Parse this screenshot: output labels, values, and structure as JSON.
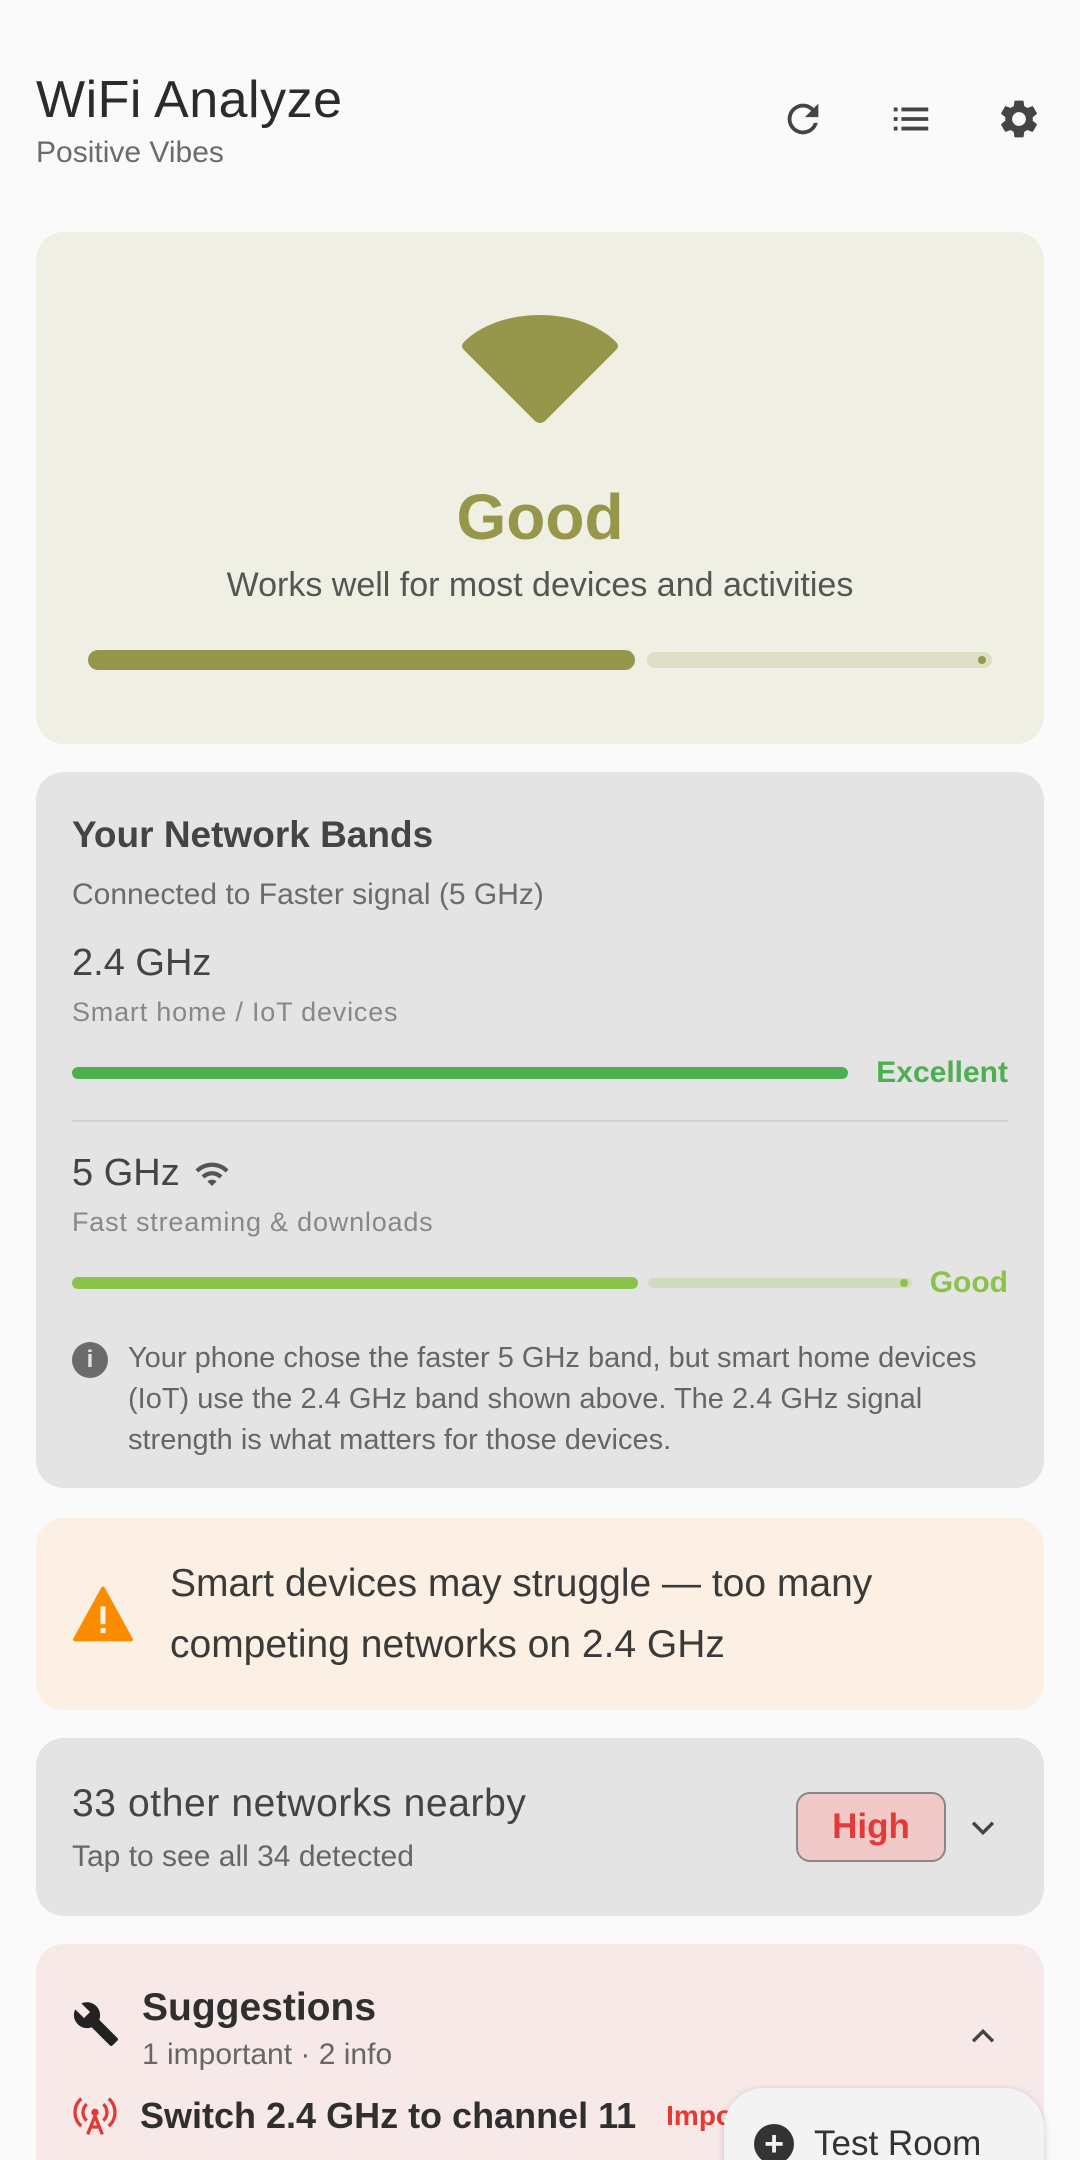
{
  "header": {
    "title": "WiFi Analyze",
    "subtitle": "Positive Vibes",
    "actions": [
      "refresh-icon",
      "list-icon",
      "settings-icon"
    ]
  },
  "status": {
    "label": "Good",
    "description": "Works well for most devices and activities",
    "level": 0.72,
    "color": "#96974a"
  },
  "bands": {
    "title": "Your Network Bands",
    "connected": "Connected to Faster signal (5 GHz)",
    "items": [
      {
        "name": "2.4 GHz",
        "desc": "Smart home / IoT devices",
        "rating": "Excellent",
        "level": 1.0,
        "color": "#4caf50"
      },
      {
        "name": "5 GHz",
        "desc": "Fast streaming & downloads",
        "rating": "Good",
        "level": 0.72,
        "color": "#8bc34a",
        "icon": "wifi-icon"
      }
    ],
    "info": "Your phone chose the faster 5 GHz band, but smart home devices (IoT) use the 2.4 GHz band shown above. The 2.4 GHz signal strength is what matters for those devices."
  },
  "warning": {
    "text": "Smart devices may struggle — too many competing networks on 2.4 GHz",
    "icon": "warning-icon",
    "color": "#fb8c00"
  },
  "nearby": {
    "title": "33 other networks nearby",
    "subtitle": "Tap to see all 34 detected",
    "badge": "High"
  },
  "suggestions": {
    "title": "Suggestions",
    "subtitle": "1 important · 2 info",
    "first_item": "Switch 2.4 GHz to channel 11",
    "first_item_tag": "Impor"
  },
  "room_chip": {
    "label": "Test Room"
  }
}
